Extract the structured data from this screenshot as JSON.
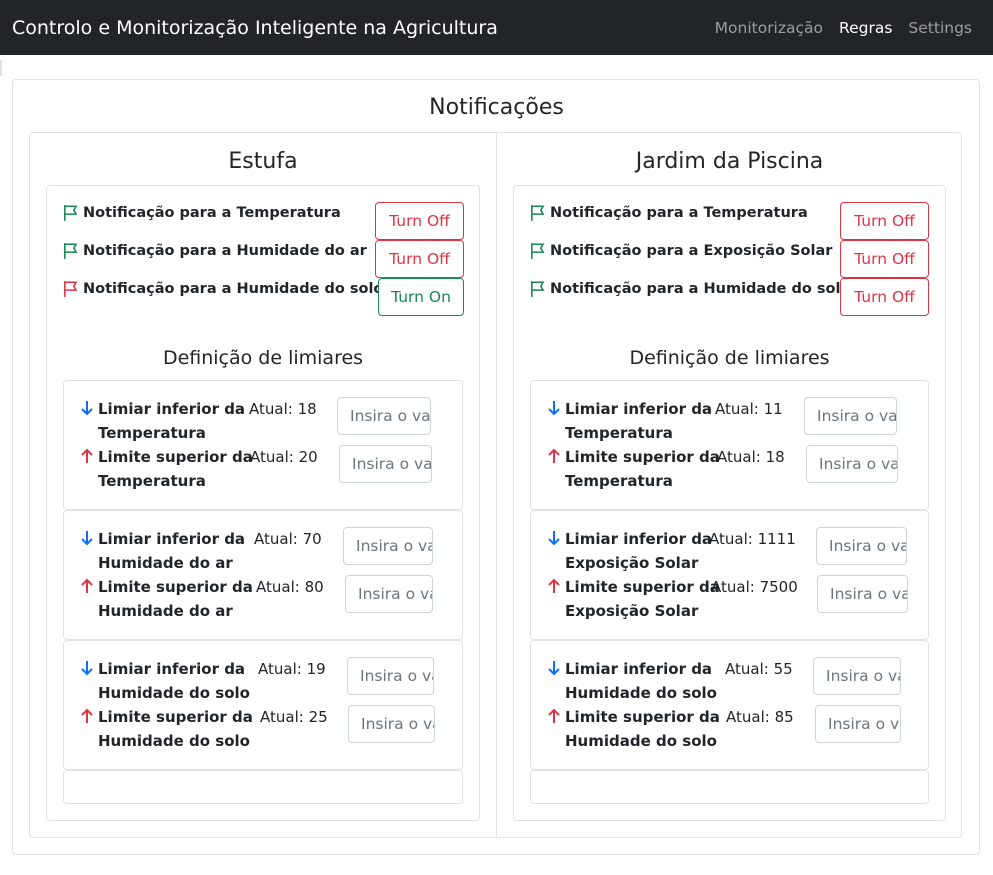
{
  "navbar": {
    "brand": "Controlo e Monitorização Inteligente na Agricultura",
    "links": [
      "Monitorização",
      "Regras",
      "Settings"
    ],
    "active": "Regras"
  },
  "page": {
    "title": "Notificações"
  },
  "colors": {
    "on": "#198754",
    "off": "#dc3545",
    "arrow_down": "#0d6efd",
    "arrow_up": "#dc3545"
  },
  "columns": [
    {
      "title": "Estufa",
      "notifications": [
        {
          "label": "Notificação para a Temperatura",
          "flag_color": "#198754",
          "button": "Turn Off"
        },
        {
          "label": "Notificação para a Humidade do ar",
          "flag_color": "#198754",
          "button": "Turn Off"
        },
        {
          "label": "Notificação para a Humidade do solo",
          "flag_color": "#dc3545",
          "button": "Turn On"
        }
      ],
      "thresholds_title": "Definição de limiares",
      "thresholds": [
        {
          "lower_l1": "Limiar inferior da",
          "lower_l2": "Temperatura",
          "lower_atual": "Atual: 18",
          "upper_l1": "Limite superior da",
          "upper_l2": "Temperatura",
          "upper_atual": "Atual: 20"
        },
        {
          "lower_l1": "Limiar inferior da",
          "lower_l2": "Humidade do ar",
          "lower_atual": "Atual: 70",
          "upper_l1": "Limite superior da",
          "upper_l2": "Humidade do ar",
          "upper_atual": "Atual: 80"
        },
        {
          "lower_l1": "Limiar inferior da",
          "lower_l2": "Humidade do solo",
          "lower_atual": "Atual: 19",
          "upper_l1": "Limite superior da",
          "upper_l2": "Humidade do solo",
          "upper_atual": "Atual: 25"
        }
      ]
    },
    {
      "title": "Jardim da Piscina",
      "notifications": [
        {
          "label": "Notificação para a Temperatura",
          "flag_color": "#198754",
          "button": "Turn Off"
        },
        {
          "label": "Notificação para a Exposição Solar",
          "flag_color": "#198754",
          "button": "Turn Off"
        },
        {
          "label": "Notificação para a Humidade do solo",
          "flag_color": "#198754",
          "button": "Turn Off"
        }
      ],
      "thresholds_title": "Definição de limiares",
      "thresholds": [
        {
          "lower_l1": "Limiar inferior da",
          "lower_l2": "Temperatura",
          "lower_atual": "Atual: 11",
          "upper_l1": "Limite superior da",
          "upper_l2": "Temperatura",
          "upper_atual": "Atual: 18"
        },
        {
          "lower_l1": "Limiar inferior da",
          "lower_l2": "Exposição Solar",
          "lower_atual": "Atual: 1111",
          "upper_l1": "Limite superior da",
          "upper_l2": "Exposição Solar",
          "upper_atual": "Atual: 7500"
        },
        {
          "lower_l1": "Limiar inferior da",
          "lower_l2": "Humidade do solo",
          "lower_atual": "Atual: 55",
          "upper_l1": "Limite superior da",
          "upper_l2": "Humidade do solo",
          "upper_atual": "Atual: 85"
        }
      ]
    }
  ],
  "input_placeholder": "Insira o valor"
}
